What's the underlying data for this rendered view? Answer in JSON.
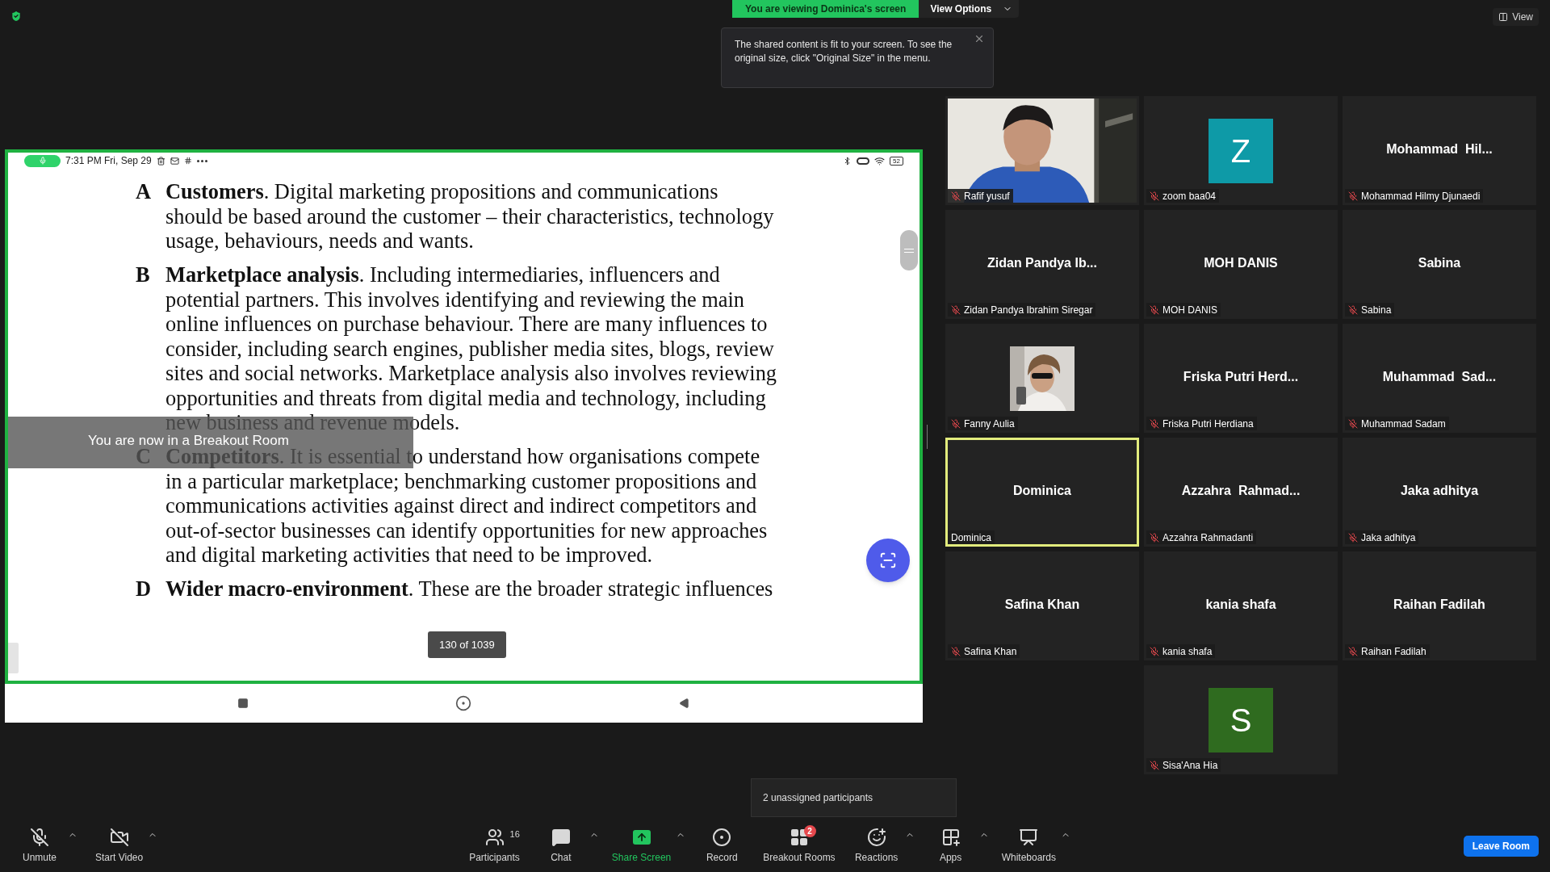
{
  "top_bar": {
    "sharing_banner": "You are viewing Dominica's screen",
    "view_options": "View Options",
    "view_button": "View"
  },
  "tooltip": {
    "text": "The shared content is fit to your screen. To see the original size, click \"Original Size\" in the menu."
  },
  "shared_screen": {
    "status_bar": {
      "time": "7:31 PM Fri, Sep 29",
      "battery": "52"
    },
    "paragraphs": [
      {
        "letter": "A",
        "lines": [
          "**Customers**. Digital marketing propositions and communications",
          "should be based around the customer – their characteristics, technology",
          "usage, behaviours, needs and wants."
        ]
      },
      {
        "letter": "B",
        "lines": [
          "**Marketplace analysis**. Including intermediaries, influencers and",
          "potential partners. This involves identifying and reviewing the main",
          "online influences on purchase behaviour. There are many influences to",
          "consider, including search engines, publisher media sites, blogs, review",
          "sites and social networks. Marketplace analysis also involves reviewing",
          "opportunities and threats from digital media and technology, including",
          "new business and revenue models."
        ]
      },
      {
        "letter": "C",
        "lines": [
          "**Competitors**. It is essential to understand how organisations compete",
          "in a particular marketplace; benchmarking customer propositions and",
          "communications activities against direct and indirect competitors and",
          "out-of-sector businesses can identify opportunities for new approaches",
          "and digital marketing activities that need to be improved."
        ]
      },
      {
        "letter": "D",
        "lines": [
          "**Wider macro-environment**. These are the broader strategic influences"
        ]
      }
    ],
    "page_counter": "130 of 1039",
    "breakout_notice": "You are now in a Breakout Room"
  },
  "participants": [
    {
      "kind": "video",
      "label": "Rafif yusuf",
      "muted": true,
      "speaking": false
    },
    {
      "kind": "avatar",
      "initial": "Z",
      "color": "#0e9aa7",
      "label": "zoom baa04",
      "muted": true,
      "speaking": false
    },
    {
      "kind": "name",
      "display_name": "Mohammad  Hil...",
      "label": "Mohammad Hilmy Djunaedi",
      "muted": true,
      "speaking": false
    },
    {
      "kind": "name",
      "display_name": "Zidan Pandya Ib...",
      "label": "Zidan Pandya Ibrahim Siregar",
      "muted": true,
      "speaking": false
    },
    {
      "kind": "name",
      "display_name": "MOH DANIS",
      "label": "MOH DANIS",
      "muted": true,
      "speaking": false
    },
    {
      "kind": "name",
      "display_name": "Sabina",
      "label": "Sabina",
      "muted": true,
      "speaking": false
    },
    {
      "label": "Fanny Aulia",
      "muted": true,
      "speaking": false
    },
    {
      "kind": "name",
      "display_name": "Friska Putri Herd...",
      "label": "Friska Putri Herdiana",
      "muted": true,
      "speaking": false
    },
    {
      "kind": "name",
      "display_name": "Muhammad  Sad...",
      "label": "Muhammad Sadam",
      "muted": true,
      "speaking": false
    },
    {
      "kind": "name",
      "display_name": "Dominica",
      "label": "Dominica",
      "muted": false,
      "speaking": true
    },
    {
      "kind": "name",
      "display_name": "Azzahra  Rahmad...",
      "label": "Azzahra Rahmadanti",
      "muted": true,
      "speaking": false
    },
    {
      "kind": "name",
      "display_name": "Jaka adhitya",
      "label": "Jaka adhitya",
      "muted": true,
      "speaking": false
    },
    {
      "kind": "name",
      "display_name": "Safina Khan",
      "label": "Safina Khan",
      "muted": true,
      "speaking": false
    },
    {
      "kind": "name",
      "display_name": "kania shafa",
      "label": "kania shafa",
      "muted": true,
      "speaking": false
    },
    {
      "kind": "name",
      "display_name": "Raihan Fadilah",
      "label": "Raihan Fadilah",
      "muted": true,
      "speaking": false
    },
    {
      "kind": "avatar",
      "initial": "S",
      "color": "#2f6b1f",
      "label": "Sisa'Ana Hia",
      "muted": true,
      "speaking": false
    }
  ],
  "unassigned_popup": "2 unassigned participants",
  "toolbar": {
    "items": [
      {
        "kind": "mic",
        "label": "Unmute",
        "off": true,
        "caret": true
      },
      {
        "kind": "video",
        "label": "Start Video",
        "off": true,
        "caret": true
      },
      {
        "kind": "participants",
        "label": "Participants",
        "count": "16",
        "caret": false
      },
      {
        "kind": "chat",
        "label": "Chat",
        "caret": true
      },
      {
        "kind": "share",
        "label": "Share Screen",
        "caret": true
      },
      {
        "kind": "record",
        "label": "Record",
        "caret": false
      },
      {
        "kind": "breakout",
        "label": "Breakout Rooms",
        "badge": "2",
        "caret": false
      },
      {
        "kind": "reactions",
        "label": "Reactions",
        "caret": true
      },
      {
        "kind": "apps",
        "label": "Apps",
        "caret": true
      },
      {
        "kind": "whiteboards",
        "label": "Whiteboards",
        "caret": true
      }
    ],
    "leave_button": "Leave Room"
  }
}
